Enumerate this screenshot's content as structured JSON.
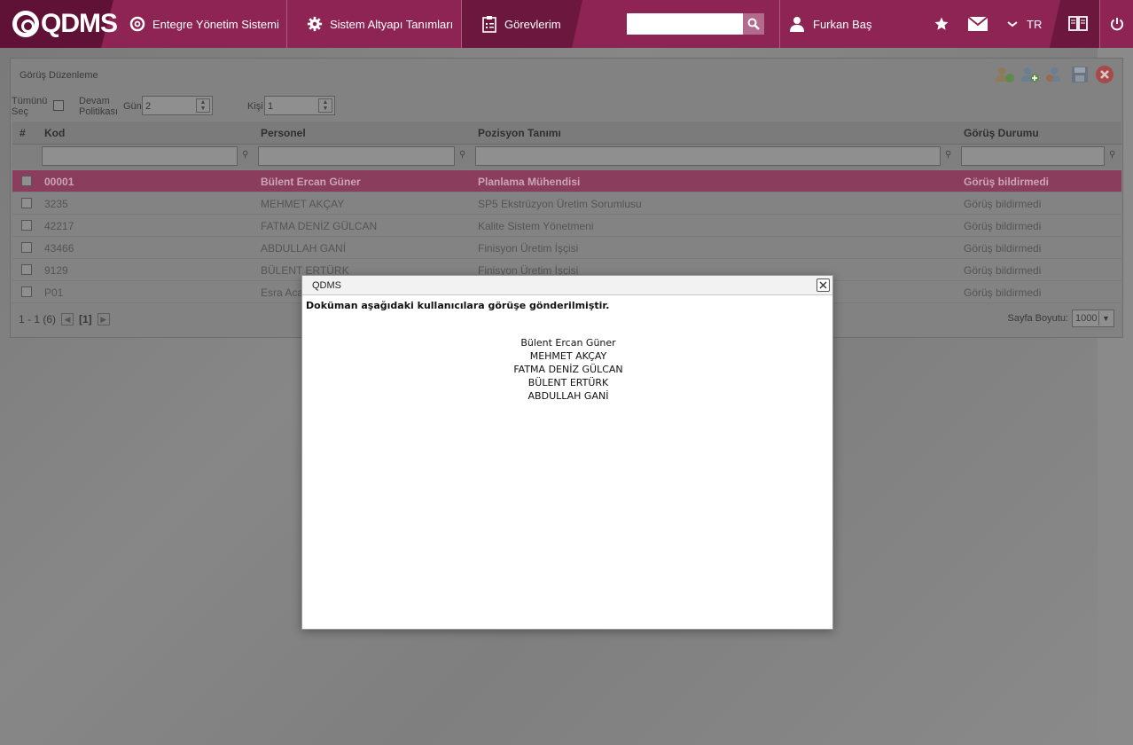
{
  "header": {
    "logo_text": "QDMS",
    "nav": [
      {
        "label": "Entegre Yönetim Sistemi",
        "icon": "q-circle-icon"
      },
      {
        "label": "Sistem Altyapı Tanımları",
        "icon": "gear-icon"
      },
      {
        "label": "Görevlerim",
        "icon": "clipboard-icon"
      }
    ],
    "search": {
      "value": "",
      "placeholder": ""
    },
    "user_name": "Furkan Baş",
    "language": "TR"
  },
  "panel": {
    "title": "Görüş Düzenleme",
    "select_all_label": "Tümünü Seç",
    "policy_label": "Devam Politikası",
    "day_label": "Gün",
    "day_value": "2",
    "person_label": "Kişi",
    "person_value": "1"
  },
  "grid": {
    "columns": {
      "num": "#",
      "code": "Kod",
      "person": "Personel",
      "position": "Pozisyon Tanımı",
      "status": "Görüş Durumu"
    },
    "rows": [
      {
        "code": "00001",
        "person": "Bülent Ercan Güner",
        "position": "Planlama Mühendisi",
        "status": "Görüş bildirmedi"
      },
      {
        "code": "3235",
        "person": "MEHMET AKÇAY",
        "position": "SP5 Ekstrüzyon Üretim Sorumlusu",
        "status": "Görüş bildirmedi"
      },
      {
        "code": "42217",
        "person": "FATMA DENİZ GÜLCAN",
        "position": "Kalite Sistem Yönetmeni",
        "status": "Görüş bildirmedi"
      },
      {
        "code": "43466",
        "person": "ABDULLAH GANİ",
        "position": "Finisyon Üretim İşçisi",
        "status": "Görüş bildirmedi"
      },
      {
        "code": "9129",
        "person": "BÜLENT ERTÜRK",
        "position": "Finisyon Üretim İşçisi",
        "status": "Görüş bildirmedi"
      },
      {
        "code": "P01",
        "person": "Esra Acar",
        "position": "",
        "status": "Görüş bildirmedi"
      }
    ],
    "pager_text": "1 - 1 (6)",
    "current_page": "[1]",
    "page_size_label": "Sayfa Boyutu:",
    "page_size_value": "1000"
  },
  "modal": {
    "title": "QDMS",
    "message": "Doküman aşağıdaki kullanıcılara görüşe gönderilmiştir.",
    "users": [
      "Bülent Ercan Güner",
      "MEHMET AKÇAY",
      "FATMA DENİZ GÜLCAN",
      "BÜLENT ERTÜRK",
      "ABDULLAH GANİ"
    ]
  }
}
